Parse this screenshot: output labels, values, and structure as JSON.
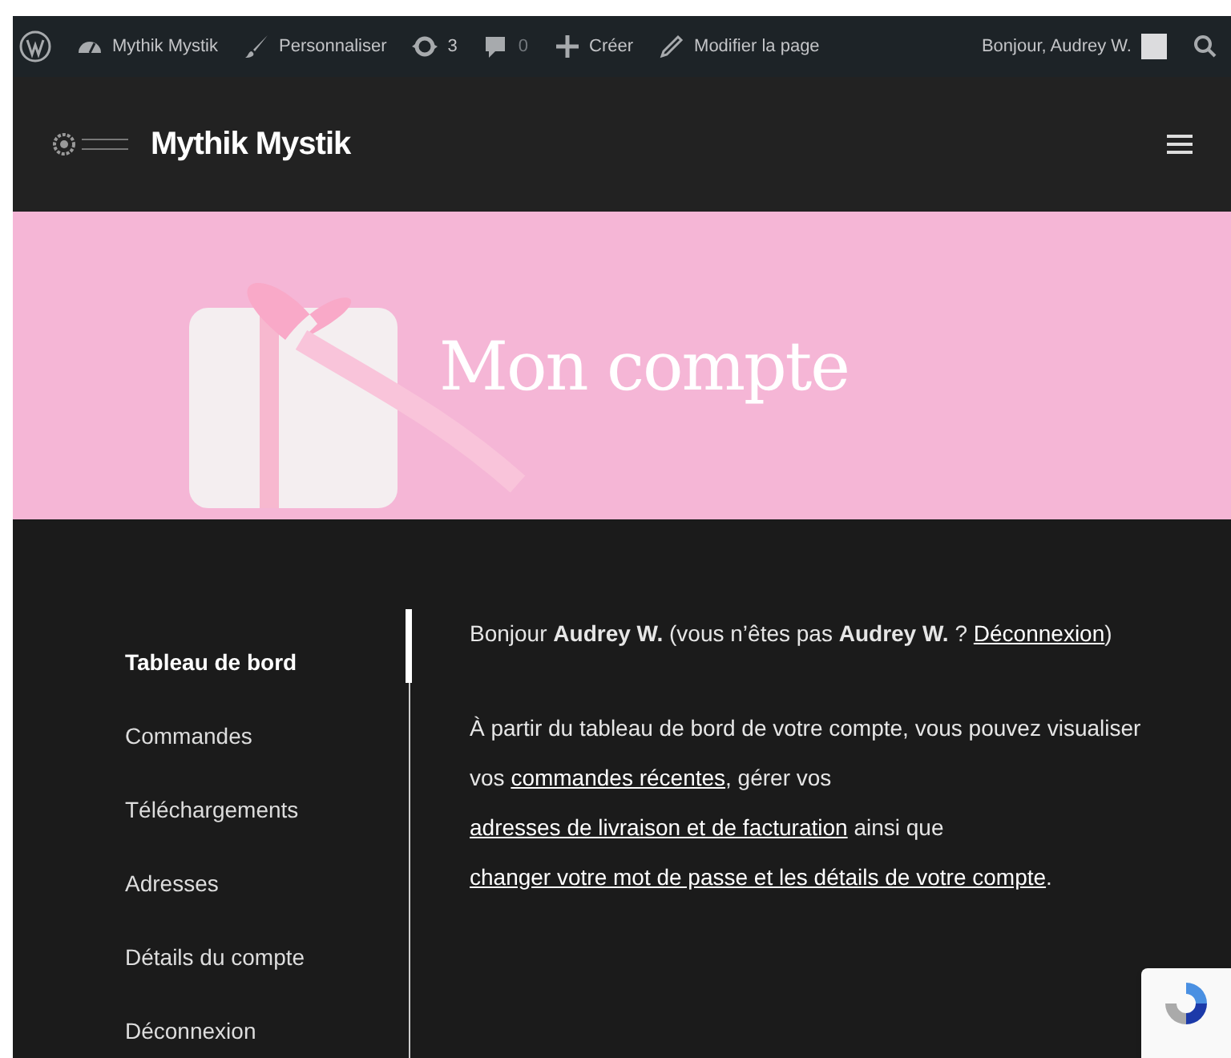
{
  "admin_bar": {
    "items": [
      {
        "kind": "wp"
      },
      {
        "kind": "site",
        "label": "Mythik Mystik"
      },
      {
        "kind": "brush",
        "label": "Personnaliser"
      },
      {
        "kind": "updates",
        "label": "3"
      },
      {
        "kind": "comments",
        "label": "0"
      },
      {
        "kind": "plus",
        "label": "Créer"
      },
      {
        "kind": "pencil",
        "label": "Modifier la page"
      }
    ],
    "greeting": "Bonjour, Audrey W."
  },
  "header": {
    "logo_text": "Mythik Mystik"
  },
  "hero": {
    "title": "Mon compte"
  },
  "account_nav": [
    {
      "label": "Tableau de bord",
      "selected": true
    },
    {
      "label": "Commandes",
      "selected": false
    },
    {
      "label": "Téléchargements",
      "selected": false
    },
    {
      "label": "Adresses",
      "selected": false
    },
    {
      "label": "Détails du compte",
      "selected": false
    },
    {
      "label": "Déconnexion",
      "selected": false
    }
  ],
  "paragraphs": [
    [
      {
        "text": "Bonjour **Audrey W.** (vous n’êtes pas **Audrey W.** ? ",
        "link": false
      },
      {
        "text": "Déconnexion",
        "link": true
      },
      {
        "text": ")",
        "link": false
      }
    ],
    [
      {
        "text": "À partir du tableau de bord de votre compte, vous pouvez visualiser vos ",
        "link": false
      },
      {
        "text": "commandes récentes",
        "link": true
      },
      {
        "text": ", gérer vos ",
        "link": false
      },
      {
        "text": "adresses de livraison et de facturation",
        "link": true
      },
      {
        "text": " ainsi que ",
        "link": false
      },
      {
        "text": "changer votre mot de passe et les détails de votre compte",
        "link": true
      },
      {
        "text": ".",
        "link": false
      }
    ]
  ]
}
